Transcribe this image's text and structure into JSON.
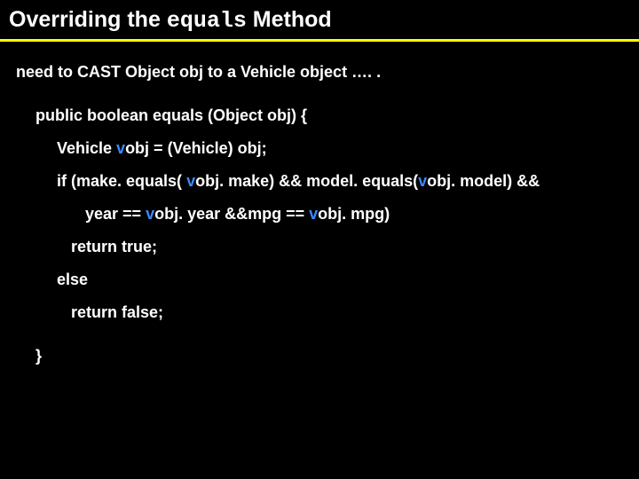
{
  "title": {
    "part1": "Overriding the ",
    "mono": "equals",
    "part2": " Method"
  },
  "intro": "need to CAST Object obj to a Vehicle object …. .",
  "code": {
    "sig": "public boolean equals (Object obj) {",
    "decl_a": "Vehicle ",
    "decl_v": "v",
    "decl_b": "obj = (Vehicle) obj;",
    "if_a": "if (make. equals( ",
    "if_v1": "v",
    "if_b": "obj. make) && model. equals(",
    "if_v2": "v",
    "if_c": "obj. model) &&",
    "y_a": "year == ",
    "y_v1": "v",
    "y_b": "obj. year &&mpg == ",
    "y_v2": "v",
    "y_c": "obj. mpg)",
    "rt": "return true;",
    "el": "else",
    "rf": "return false;",
    "close": "}"
  }
}
